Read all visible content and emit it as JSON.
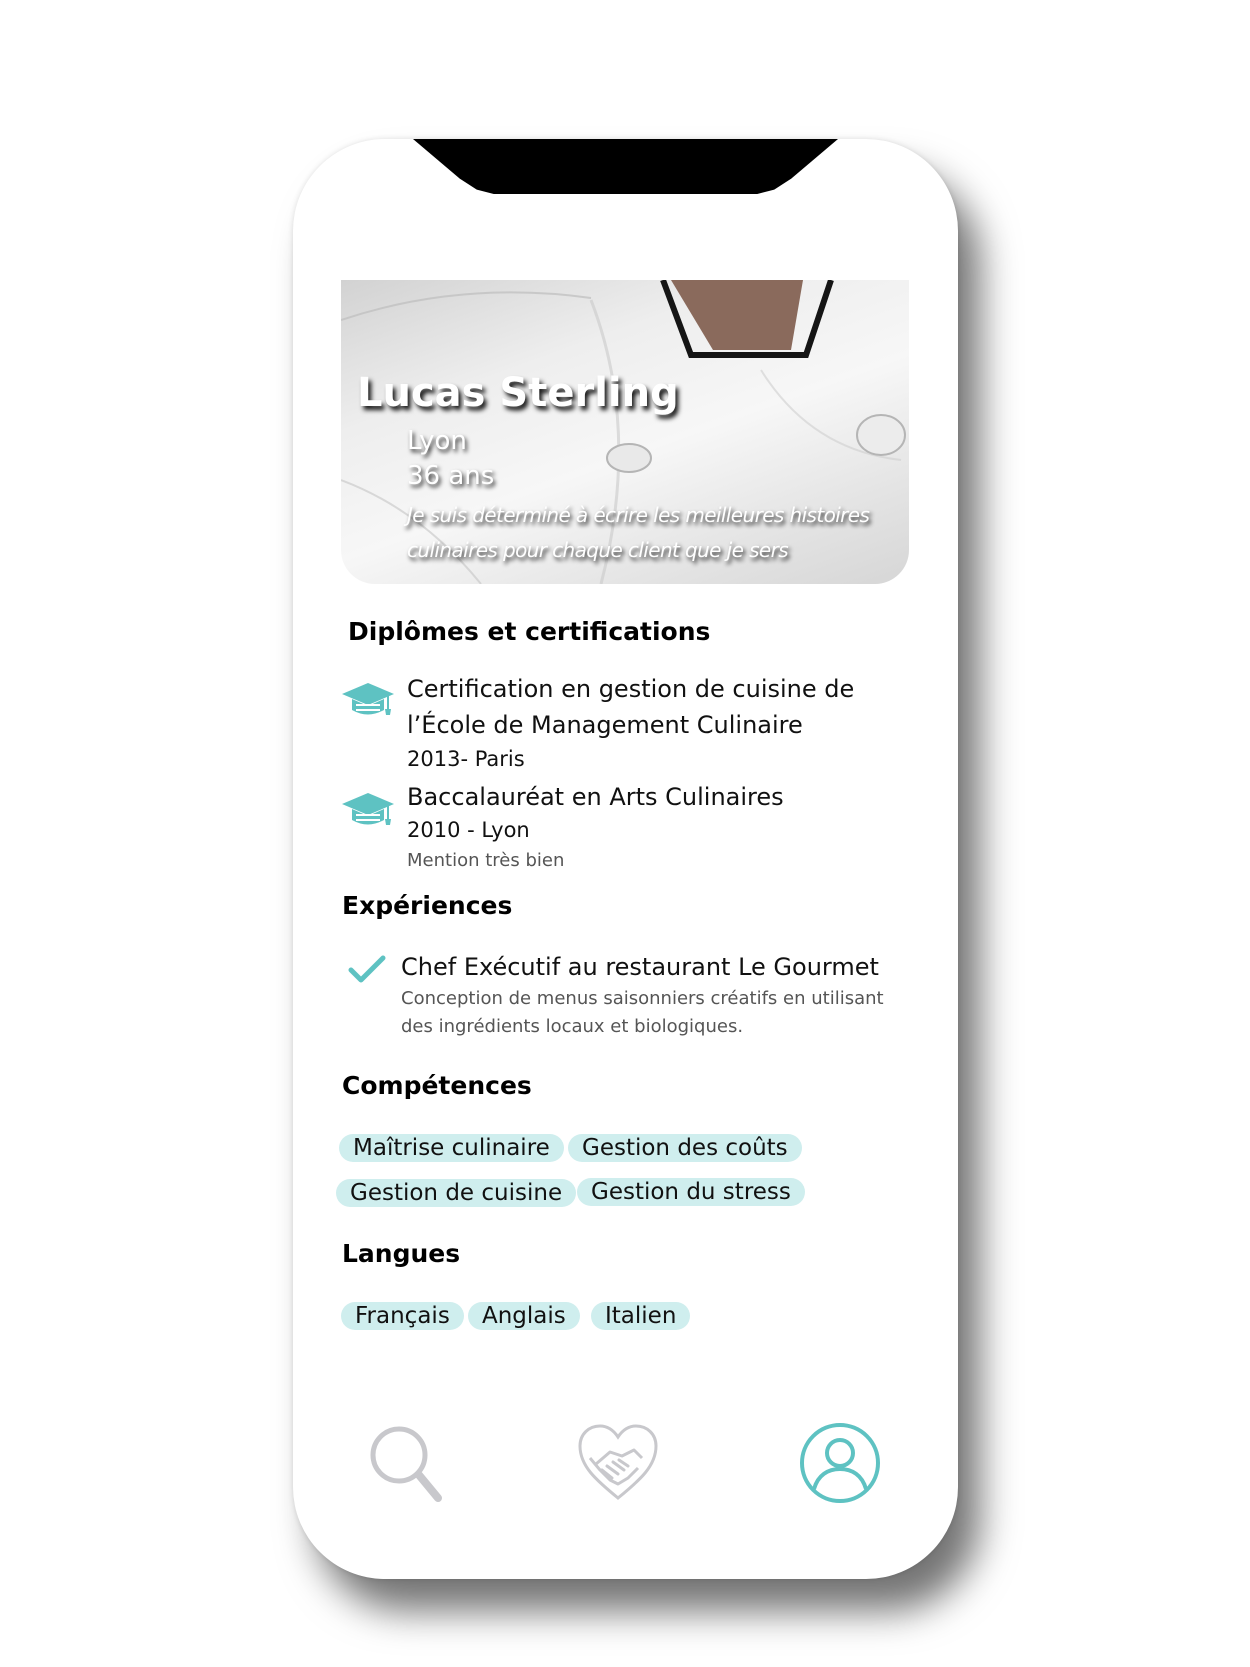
{
  "profile": {
    "name": "Lucas Sterling",
    "city": "Lyon",
    "age": "36 ans",
    "quote": "Je suis déterminé à écrire les meilleures histoires culinaires pour chaque client que je sers"
  },
  "diplomas": {
    "title": "Diplômes et certifications",
    "items": [
      {
        "title": "Certification en gestion de cuisine de l’École de Management Culinaire",
        "sub": "2013- Paris",
        "icon": "graduation-cap-icon"
      },
      {
        "title": "Baccalauréat en Arts Culinaires",
        "sub": "2010 - Lyon",
        "note": "Mention très bien",
        "icon": "graduation-cap-icon"
      }
    ]
  },
  "experiences": {
    "title": "Expériences",
    "items": [
      {
        "title": "Chef Exécutif au restaurant Le Gourmet",
        "description": "Conception de menus saisonniers créatifs en utilisant des ingrédients locaux et biologiques.",
        "icon": "checkmark-icon"
      }
    ]
  },
  "skills": {
    "title": "Compétences",
    "items": [
      "Maîtrise culinaire",
      "Gestion des coûts",
      "Gestion de cuisine",
      "Gestion du stress"
    ]
  },
  "languages": {
    "title": "Langues",
    "items": [
      "Français",
      "Anglais",
      "Italien"
    ]
  },
  "nav": {
    "items": [
      {
        "icon": "search-icon",
        "active": false
      },
      {
        "icon": "heart-handshake-icon",
        "active": false
      },
      {
        "icon": "user-profile-icon",
        "active": true
      }
    ]
  },
  "colors": {
    "accent": "#5ec2c2",
    "tag_background": "#cfeeee",
    "inactive_icon": "#c8c8cc"
  }
}
